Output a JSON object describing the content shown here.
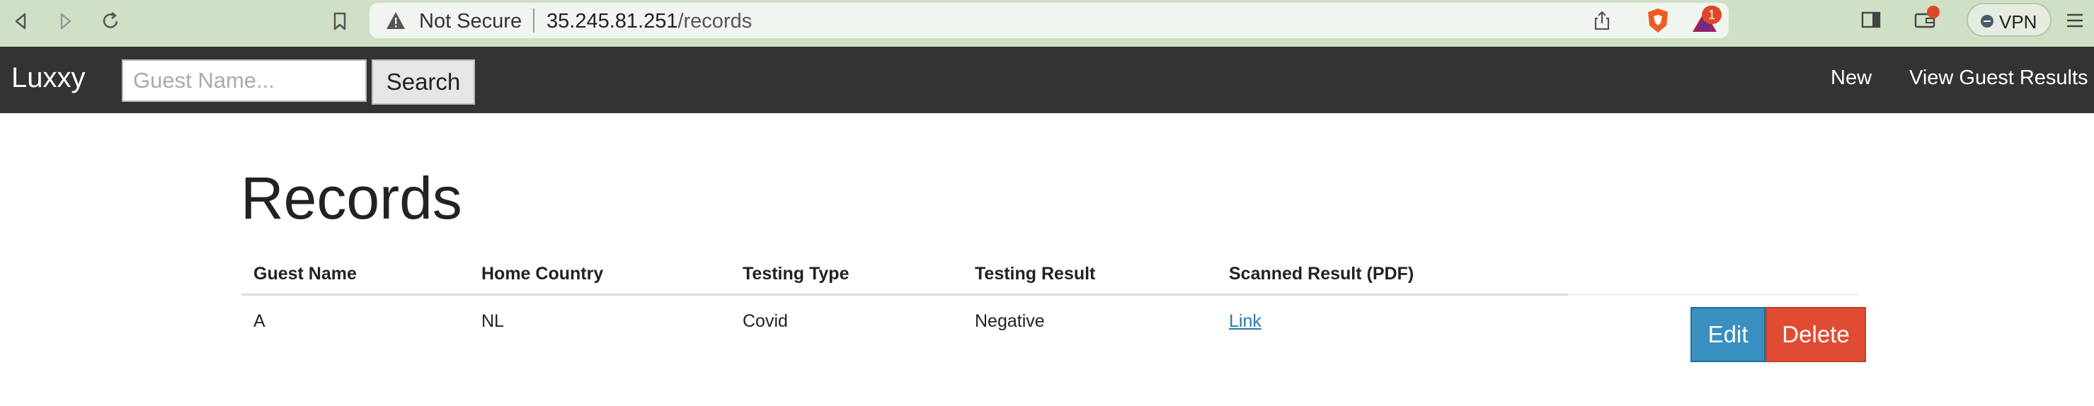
{
  "browser": {
    "security_label": "Not Secure",
    "url_host": "35.245.81.251",
    "url_path": "/records",
    "bat_badge_count": "1",
    "vpn_label": "VPN"
  },
  "navbar": {
    "brand": "Luxxy",
    "search_placeholder": "Guest Name...",
    "search_button": "Search",
    "links": [
      "New",
      "View Guest Results"
    ]
  },
  "page": {
    "title": "Records"
  },
  "table": {
    "headers": [
      "Guest Name",
      "Home Country",
      "Testing Type",
      "Testing Result",
      "Scanned Result (PDF)"
    ],
    "rows": [
      {
        "guest_name": "A",
        "home_country": "NL",
        "testing_type": "Covid",
        "testing_result": "Negative",
        "scanned_result_link": "Link",
        "actions": {
          "edit": "Edit",
          "delete": "Delete"
        }
      }
    ]
  },
  "colors": {
    "navbar_bg": "#333333",
    "edit_button": "#3a8fc1",
    "delete_button": "#e04c33",
    "link": "#2a7ab0",
    "chrome_bg": "#cfe0c6"
  }
}
